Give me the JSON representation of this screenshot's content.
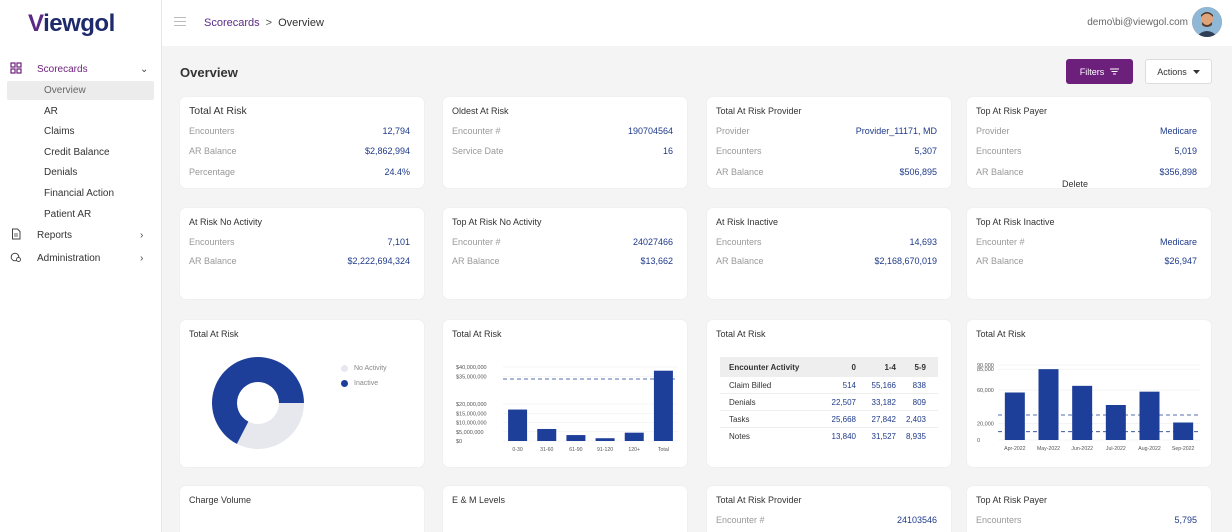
{
  "app": {
    "logo": "Viewgol",
    "logo_v": "V",
    "logo_rest": "iewgol"
  },
  "sidebar": {
    "scorecards": "Scorecards",
    "sub": [
      "Overview",
      "AR",
      "Claims",
      "Credit Balance",
      "Denials",
      "Financial Action",
      "Patient AR"
    ],
    "reports": "Reports",
    "administration": "Administration"
  },
  "header": {
    "breadcrumb_root": "Scorecards",
    "breadcrumb_sep": ">",
    "breadcrumb_current": "Overview",
    "user": "demo\\bi@viewgol.com"
  },
  "page": {
    "title": "Overview",
    "filters": "Filters",
    "actions": "Actions",
    "delete": "Delete"
  },
  "colors": {
    "accent": "#6d1f7c",
    "value": "#1e3a8a",
    "bar": "#1e3f99",
    "donut_light": "#e6e8ee"
  },
  "cards": {
    "total_at_risk": {
      "title": "Total At Risk",
      "rows": [
        [
          "Encounters",
          "12,794"
        ],
        [
          "AR Balance",
          "$2,862,994"
        ],
        [
          "Percentage",
          "24.4%"
        ]
      ]
    },
    "oldest_at_risk": {
      "title": "Oldest At Risk",
      "rows": [
        [
          "Encounter #",
          "190704564"
        ],
        [
          "Service Date",
          "16"
        ]
      ]
    },
    "total_at_risk_provider": {
      "title": "Total At Risk Provider",
      "rows": [
        [
          "Provider",
          "Provider_11171, MD"
        ],
        [
          "Encounters",
          "5,307"
        ],
        [
          "AR Balance",
          "$506,895"
        ]
      ]
    },
    "top_at_risk_payer": {
      "title": "Top At Risk Payer",
      "rows": [
        [
          "Provider",
          "Medicare"
        ],
        [
          "Encounters",
          "5,019"
        ],
        [
          "AR Balance",
          "$356,898"
        ]
      ]
    },
    "at_risk_no_activity": {
      "title": "At Risk No Activity",
      "rows": [
        [
          "Encounters",
          "7,101"
        ],
        [
          "AR Balance",
          "$2,222,694,324"
        ]
      ]
    },
    "top_at_risk_no_activity": {
      "title": "Top At Risk No Activity",
      "rows": [
        [
          "Encounter #",
          "24027466"
        ],
        [
          "AR Balance",
          "$13,662"
        ]
      ]
    },
    "at_risk_inactive": {
      "title": "At Risk Inactive",
      "rows": [
        [
          "Encounters",
          "14,693"
        ],
        [
          "AR Balance",
          "$2,168,670,019"
        ]
      ]
    },
    "top_at_risk_inactive": {
      "title": "Top At Risk Inactive",
      "rows": [
        [
          "Encounter #",
          "Medicare"
        ],
        [
          "AR Balance",
          "$26,947"
        ]
      ]
    }
  },
  "charts_titles": {
    "donut": "Total At Risk",
    "bar1": "Total At Risk",
    "table": "Total At Risk",
    "bar2": "Total At Risk"
  },
  "bottom": {
    "charge_volume": "Charge Volume",
    "em_levels": "E & M Levels",
    "provider": {
      "title": "Total At Risk Provider",
      "label": "Encounter #",
      "value": "24103546"
    },
    "payer": {
      "title": "Top At Risk Payer",
      "label": "Encounters",
      "value": "5,795"
    }
  },
  "chart_data": [
    {
      "type": "pie",
      "title": "Total At Risk",
      "labels": [
        "No Activity",
        "Inactive"
      ],
      "values": [
        7101,
        14693
      ],
      "colors": [
        "#e6e8ee",
        "#1e3f99"
      ]
    },
    {
      "type": "bar",
      "title": "Total At Risk",
      "categories": [
        "0-30",
        "31-60",
        "61-90",
        "91-120",
        "120+",
        "Total"
      ],
      "values": [
        17000000,
        6500000,
        3200000,
        1500000,
        4500000,
        38000000
      ],
      "yticks": [
        "$40,000,000",
        "$35,000,000",
        "$20,000,000",
        "$15,000,000",
        "$10,000,000",
        "$5,000,000",
        "$0"
      ],
      "ytick_values": [
        40000000,
        35000000,
        20000000,
        15000000,
        10000000,
        5000000,
        0
      ],
      "ylim": [
        0,
        40000000
      ],
      "reference_line": 33500000
    },
    {
      "type": "table",
      "title": "Total At Risk",
      "columns": [
        "Encounter Activity",
        "0",
        "1-4",
        "5-9"
      ],
      "rows": [
        [
          "Claim Billed",
          "514",
          "55,166",
          "838"
        ],
        [
          "Denials",
          "22,507",
          "33,182",
          "809"
        ],
        [
          "Tasks",
          "25,668",
          "27,842",
          "2,403"
        ],
        [
          "Notes",
          "13,840",
          "31,527",
          "8,935"
        ]
      ]
    },
    {
      "type": "bar",
      "title": "Total At Risk",
      "categories": [
        "Apr-2022",
        "May-2022",
        "Jun-2022",
        "Jul-2022",
        "Aug-2022",
        "Sep-2022"
      ],
      "values": [
        57000,
        85000,
        65000,
        42000,
        58000,
        21000
      ],
      "yticks": [
        "90,000",
        "85,000",
        "60,000",
        "20,000",
        "0"
      ],
      "ytick_values": [
        90000,
        85000,
        60000,
        20000,
        0
      ],
      "ylim": [
        0,
        90000
      ],
      "reference_lines": [
        30000,
        10000
      ]
    }
  ]
}
